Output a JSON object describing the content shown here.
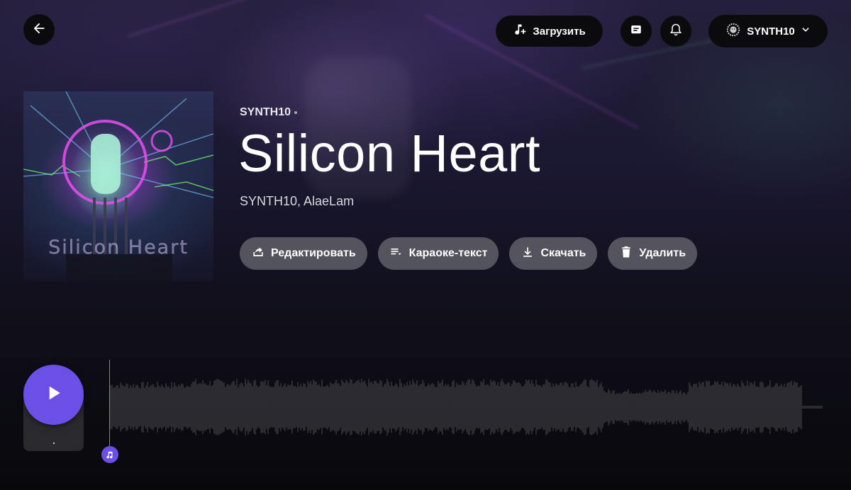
{
  "header": {
    "upload_label": "Загрузить",
    "user_name": "SYNTH10",
    "icons": {
      "back": "arrow-left-icon",
      "upload": "music-note-plus-icon",
      "messages": "message-icon",
      "notifications": "bell-icon",
      "avatar": "lion-avatar-icon",
      "dropdown": "chevron-down-icon"
    }
  },
  "track": {
    "owner": "SYNTH10",
    "title": "Silicon Heart",
    "artists": "SYNTH10, AlaeLam",
    "cover_text": "Silicon Heart"
  },
  "actions": [
    {
      "label": "Редактировать",
      "icon": "share-edit-icon"
    },
    {
      "label": "Караоке-текст",
      "icon": "lyrics-icon"
    },
    {
      "label": "Скачать",
      "icon": "download-icon"
    },
    {
      "label": "Удалить",
      "icon": "trash-icon"
    }
  ],
  "player": {
    "play_icon": "play-icon",
    "badge_icon": "music-badge-icon",
    "accent": "#6b4fe6",
    "progress": 0
  }
}
